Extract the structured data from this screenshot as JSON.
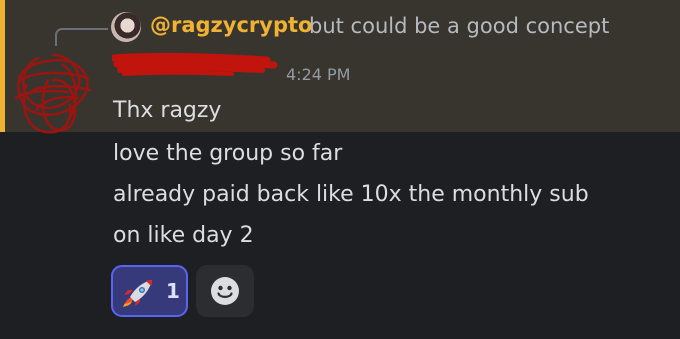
{
  "reply": {
    "username": "@ragzycrypto",
    "snippet": "but could be a good concept"
  },
  "message": {
    "author_redacted": true,
    "timestamp": "4:24 PM",
    "lines": [
      "Thx ragzy",
      "love the group so far",
      "already paid back like 10x the monthly sub",
      "on like day 2"
    ]
  },
  "reactions": [
    {
      "emoji": "rocket-icon",
      "count": "1",
      "active": true
    }
  ],
  "add_reaction": {
    "icon": "smiley-icon"
  },
  "colors": {
    "background": "#1e1f22",
    "highlight": "#38352f",
    "highlight_bar": "#f0b232",
    "mention": "#f0b232",
    "reaction_border": "#5865f2",
    "redaction": "#c0140c"
  }
}
